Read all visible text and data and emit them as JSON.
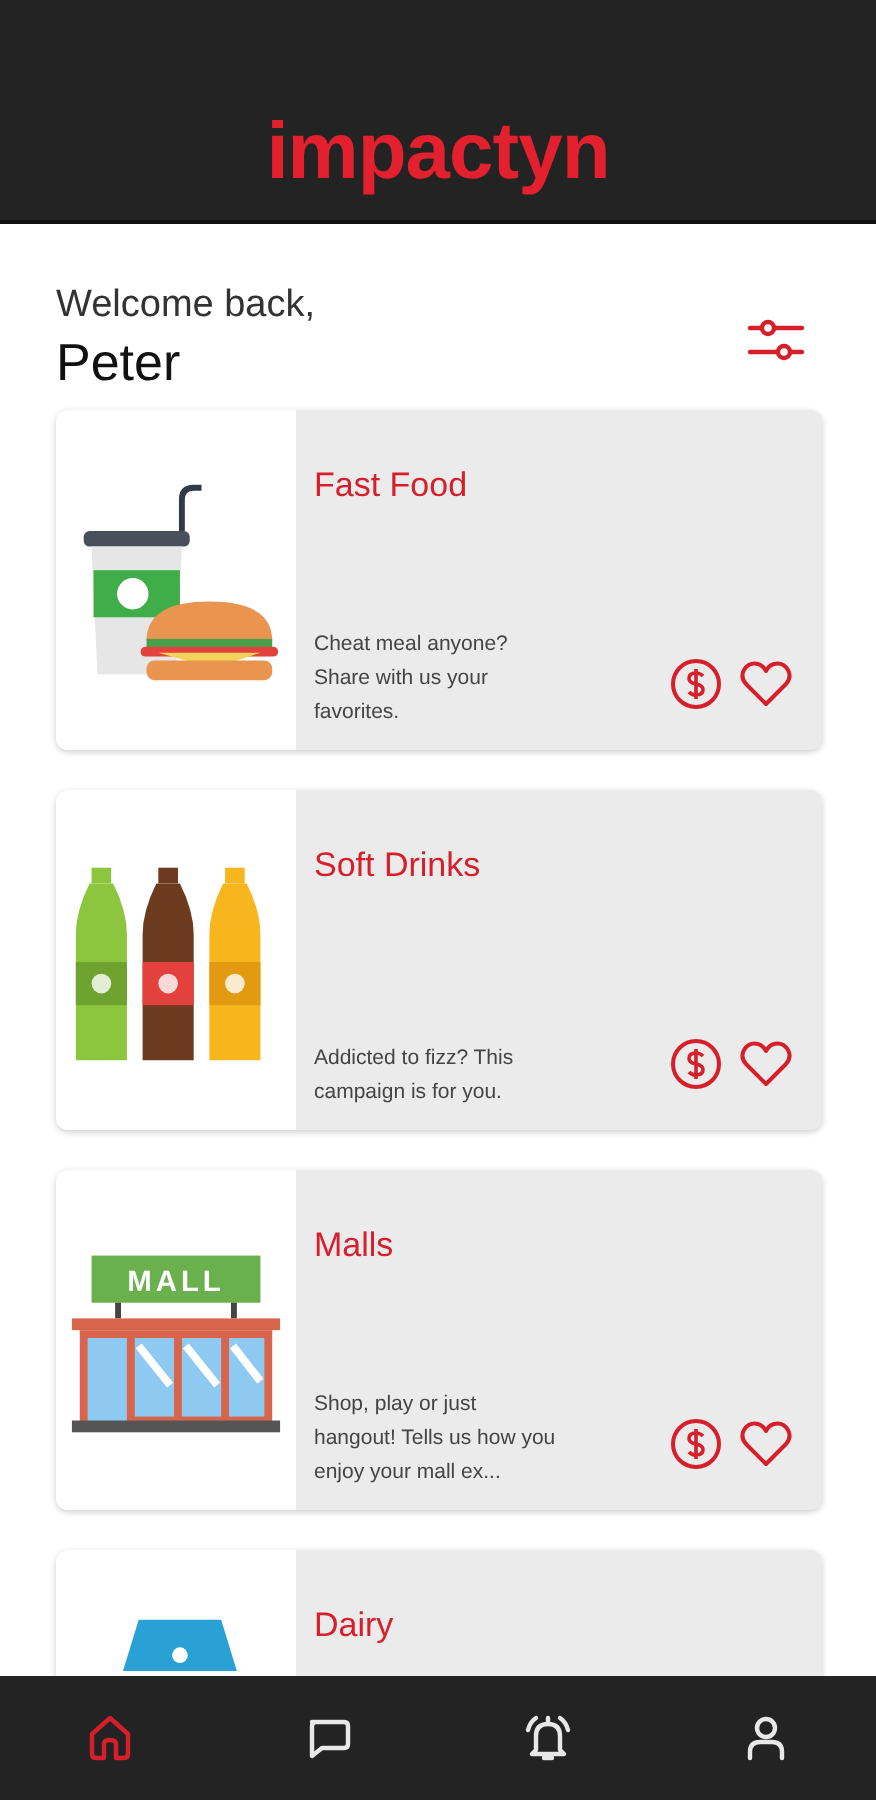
{
  "app_bar": {
    "logo": "impactyn"
  },
  "greeting": {
    "line": "Welcome back,",
    "name": "Peter"
  },
  "cards": [
    {
      "kind": "fast-food",
      "title": "Fast Food",
      "description": "Cheat meal anyone? Share with us your favorites."
    },
    {
      "kind": "soft-drinks",
      "title": "Soft Drinks",
      "description": "Addicted to fizz? This campaign is for you."
    },
    {
      "kind": "mall",
      "title": "Malls",
      "sign": "MALL",
      "description": "Shop, play or just hangout! Tells us how you enjoy your mall ex..."
    },
    {
      "kind": "dairy",
      "title": "Dairy"
    }
  ],
  "bottom_nav": [
    {
      "kind": "home",
      "selected": true
    },
    {
      "kind": "chat",
      "selected": false
    },
    {
      "kind": "bell",
      "selected": false
    },
    {
      "kind": "profile",
      "selected": false
    }
  ]
}
